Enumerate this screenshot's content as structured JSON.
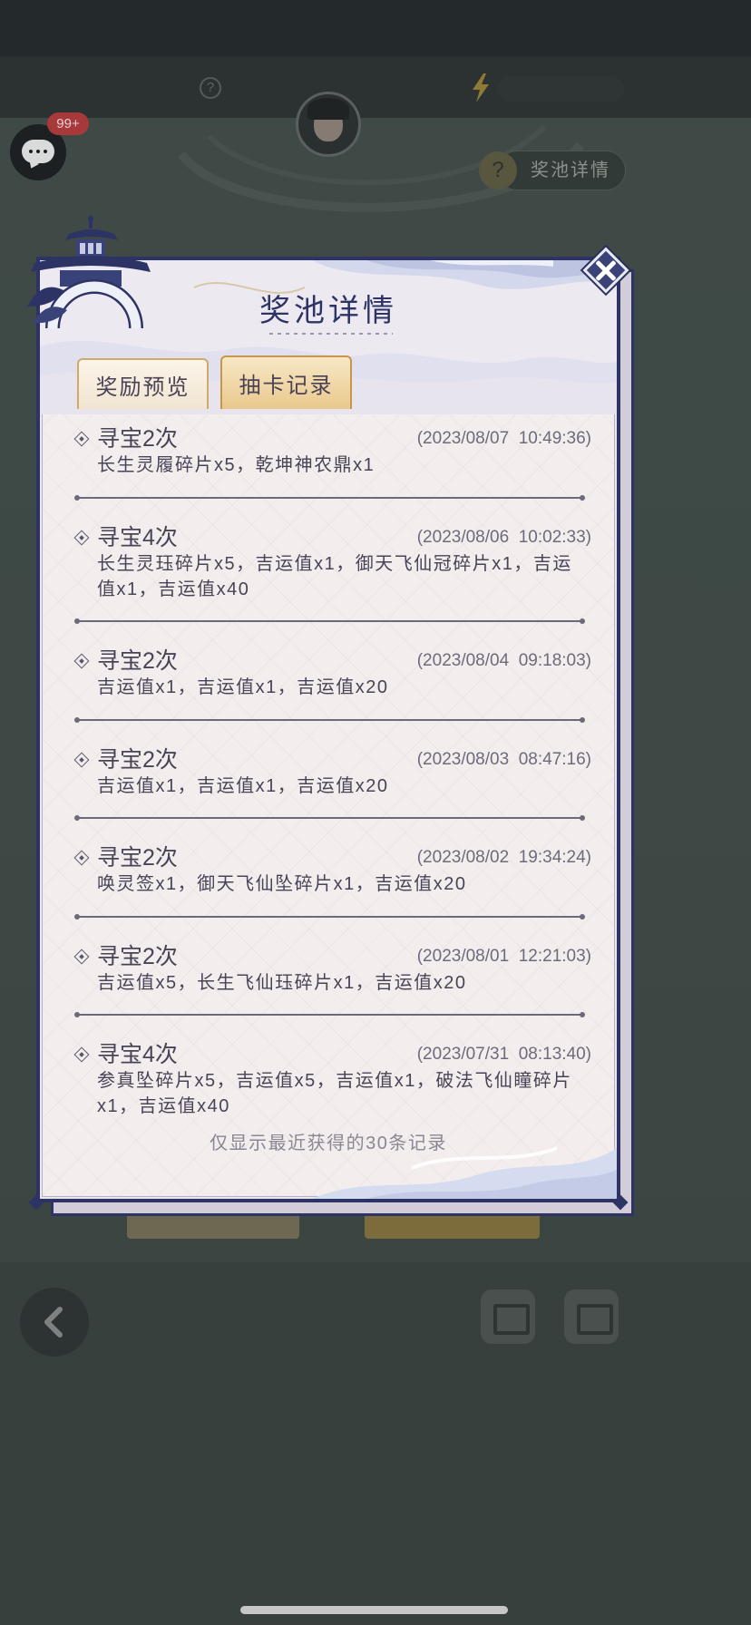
{
  "background": {
    "chat_badge": "99+",
    "rules_button_label": "奖池详情"
  },
  "dialog": {
    "title": "奖池详情",
    "tabs": [
      {
        "label": "奖励预览",
        "selected": false
      },
      {
        "label": "抽卡记录",
        "selected": true
      }
    ],
    "records": [
      {
        "title": "寻宝2次",
        "time": "(2023/08/07  10:49:36)",
        "items": "长生灵履碎片x5，乾坤神农鼎x1"
      },
      {
        "title": "寻宝4次",
        "time": "(2023/08/06  10:02:33)",
        "items": "长生灵珏碎片x5，吉运值x1，御天飞仙冠碎片x1，吉运值x1，吉运值x40"
      },
      {
        "title": "寻宝2次",
        "time": "(2023/08/04  09:18:03)",
        "items": "吉运值x1，吉运值x1，吉运值x20"
      },
      {
        "title": "寻宝2次",
        "time": "(2023/08/03  08:47:16)",
        "items": "吉运值x1，吉运值x1，吉运值x20"
      },
      {
        "title": "寻宝2次",
        "time": "(2023/08/02  19:34:24)",
        "items": "唤灵签x1，御天飞仙坠碎片x1，吉运值x20"
      },
      {
        "title": "寻宝2次",
        "time": "(2023/08/01  12:21:03)",
        "items": "吉运值x5，长生飞仙珏碎片x1，吉运值x20"
      },
      {
        "title": "寻宝4次",
        "time": "(2023/07/31  08:13:40)",
        "items": "参真坠碎片x5，吉运值x5，吉运值x1，破法飞仙瞳碎片x1，吉运值x40"
      }
    ],
    "footer_note": "仅显示最近获得的30条记录"
  },
  "icons": {
    "chat": "chat-bubble-icon",
    "help": "help-icon",
    "currency": "lightning-icon",
    "avatar": "avatar",
    "close": "close-icon",
    "bullet": "diamond-bullet-icon",
    "emblem": "pagoda-emblem-icon",
    "back": "back-arrow-icon",
    "menu_left": "chest-icon",
    "menu_right": "gift-icon"
  },
  "colors": {
    "frame_navy": "#2d3364",
    "paper": "#f3eded",
    "text": "#4a4356",
    "timestamp": "#6f6a7a",
    "note": "#8b8693",
    "badge_red": "#a7393a",
    "selected_tab_gold": "#e9c88c",
    "overlay_bg": "#3c4643"
  }
}
